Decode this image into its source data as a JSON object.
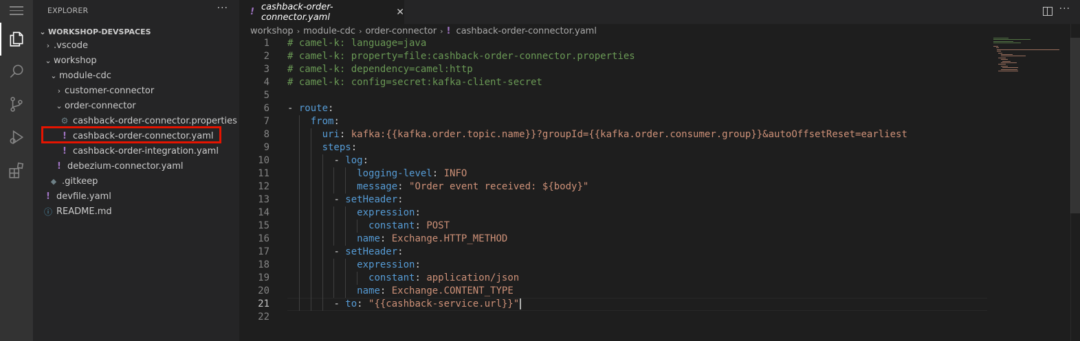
{
  "sidebar": {
    "title": "EXPLORER",
    "more": "···",
    "section": "WORKSHOP-DEVSPACES",
    "items": [
      {
        "label": ".vscode",
        "icon": "chevron-right-icon"
      },
      {
        "label": "workshop",
        "icon": "chevron-down-icon"
      },
      {
        "label": "module-cdc",
        "icon": "chevron-down-icon"
      },
      {
        "label": "customer-connector",
        "icon": "chevron-right-icon"
      },
      {
        "label": "order-connector",
        "icon": "chevron-down-icon"
      },
      {
        "label": "cashback-order-connector.properties",
        "icon": "gear-icon"
      },
      {
        "label": "cashback-order-connector.yaml",
        "icon": "yaml-icon",
        "highlighted": true
      },
      {
        "label": "cashback-order-integration.yaml",
        "icon": "yaml-icon"
      },
      {
        "label": "debezium-connector.yaml",
        "icon": "yaml-icon"
      },
      {
        "label": ".gitkeep",
        "icon": "git-icon"
      },
      {
        "label": "devfile.yaml",
        "icon": "yaml-icon"
      },
      {
        "label": "README.md",
        "icon": "info-icon"
      }
    ]
  },
  "tab": {
    "icon": "!",
    "label": "cashback-order-connector.yaml",
    "close": "✕"
  },
  "breadcrumb": [
    "workshop",
    "module-cdc",
    "order-connector",
    "cashback-order-connector.yaml"
  ],
  "editor": {
    "current_line": 21,
    "lines": [
      "# camel-k: language=java",
      "# camel-k: property=file:cashback-order-connector.properties",
      "# camel-k: dependency=camel:http",
      "# camel-k: config=secret:kafka-client-secret",
      "",
      "- route:",
      "    from:",
      "      uri: kafka:{{kafka.order.topic.name}}?groupId={{kafka.order.consumer.group}}&autoOffsetReset=earliest",
      "      steps:",
      "        - log:",
      "            logging-level: INFO",
      "            message: \"Order event received: ${body}\"",
      "        - setHeader:",
      "            expression:",
      "              constant: POST",
      "            name: Exchange.HTTP_METHOD",
      "        - setHeader:",
      "            expression:",
      "              constant: application/json",
      "            name: Exchange.CONTENT_TYPE",
      "        - to: \"{{cashback-service.url}}\"",
      ""
    ]
  },
  "colors": {
    "comment": "#6a9955",
    "key": "#569cd6",
    "string": "#ce9178",
    "yaml_icon": "#a074c4",
    "highlight_border": "#e51400"
  }
}
